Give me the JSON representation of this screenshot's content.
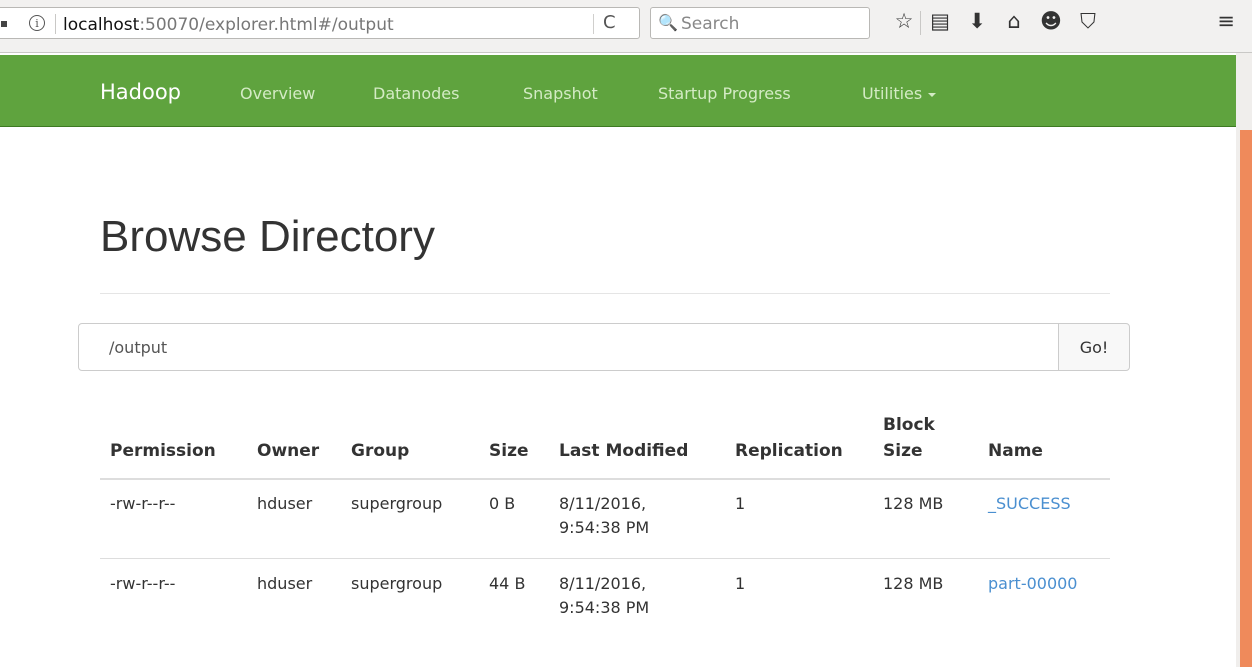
{
  "browser": {
    "url_host": "localhost",
    "url_path": ":50070/explorer.html#/output",
    "search_placeholder": "Search",
    "info_glyph": "i",
    "reload_glyph": "C",
    "search_glyph": "🔍",
    "icons": {
      "bookmark": "☆",
      "library": "▤",
      "download": "⬇",
      "home": "⌂",
      "chat": "☻",
      "pocket": "⛉",
      "menu": "≡"
    }
  },
  "navbar": {
    "brand": "Hadoop",
    "items": [
      "Overview",
      "Datanodes",
      "Snapshot",
      "Startup Progress",
      "Utilities"
    ],
    "color": "#5fa33e"
  },
  "page": {
    "title": "Browse Directory",
    "path_value": "/output",
    "go_label": "Go!"
  },
  "table": {
    "headers": {
      "permission": "Permission",
      "owner": "Owner",
      "group": "Group",
      "size": "Size",
      "last_modified": "Last Modified",
      "replication": "Replication",
      "block_size_line1": "Block",
      "block_size_line2": "Size",
      "name": "Name"
    },
    "rows": [
      {
        "permission": "-rw-r--r--",
        "owner": "hduser",
        "group": "supergroup",
        "size": "0 B",
        "date": "8/11/2016,",
        "time": "9:54:38 PM",
        "replication": "1",
        "block_size": "128 MB",
        "name": "_SUCCESS"
      },
      {
        "permission": "-rw-r--r--",
        "owner": "hduser",
        "group": "supergroup",
        "size": "44 B",
        "date": "8/11/2016,",
        "time": "9:54:38 PM",
        "replication": "1",
        "block_size": "128 MB",
        "name": "part-00000"
      }
    ],
    "link_color": "#4a8fd0"
  }
}
